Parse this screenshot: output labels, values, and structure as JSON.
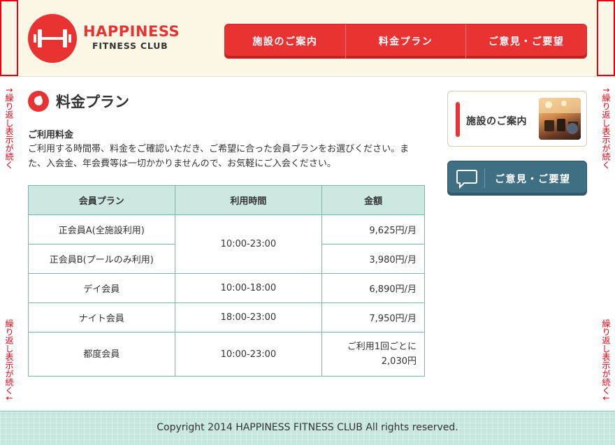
{
  "colors": {
    "brand_red": "#e93232",
    "header_bg": "#fdf8e6",
    "table_head": "#cde8e2",
    "teal_button": "#3f6f83",
    "marker_red": "#e60012"
  },
  "logo": {
    "title": "HAPPINESS",
    "subtitle": "FITNESS CLUB",
    "icon": "dumbbell-icon"
  },
  "nav": {
    "items": [
      "施設のご案内",
      "料金プラン",
      "ご意見・ご要望"
    ]
  },
  "markers": {
    "label_up": "↑繰り返し表示が続く",
    "label_down": "繰り返し表示が続く↓"
  },
  "main": {
    "title": "料金プラン",
    "title_icon": "leaf-icon",
    "section_heading": "ご利用料金",
    "intro": "ご利用する時間帯、料金をご確認いただき、ご希望に合った会員プランをお選びください。また、入会金、年会費等は一切かかりませんので、お気軽にご入会ください。"
  },
  "table": {
    "headers": [
      "会員プラン",
      "利用時間",
      "金額"
    ],
    "rows": [
      {
        "plan": "正会員A(全施設利用)",
        "time": "10:00-23:00",
        "price": "9,625円/月"
      },
      {
        "plan": "正会員B(プールのみ利用)",
        "time": "",
        "price": "3,980円/月"
      },
      {
        "plan": "デイ会員",
        "time": "10:00-18:00",
        "price": "6,890円/月"
      },
      {
        "plan": "ナイト会員",
        "time": "18:00-23:00",
        "price": "7,950円/月"
      },
      {
        "plan": "都度会員",
        "time": "10:00-23:00",
        "price_line1": "ご利用1回ごとに",
        "price_line2": "2,030円"
      }
    ]
  },
  "side": {
    "facility_label": "施設のご案内",
    "feedback_label": "ご意見・ご要望",
    "feedback_icon": "speech-bubble-icon"
  },
  "footer": {
    "copyright": "Copyright 2014 HAPPINESS FITNESS CLUB All rights reserved."
  }
}
